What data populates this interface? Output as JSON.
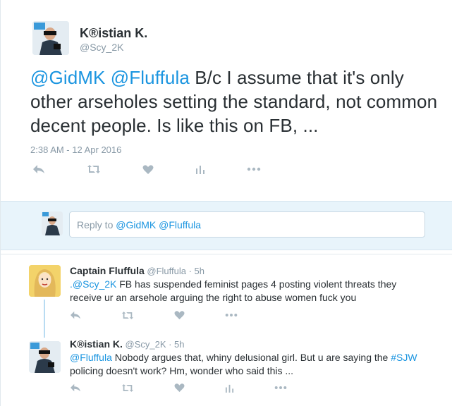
{
  "main_tweet": {
    "name": "K®istian K.",
    "handle": "@Scy_2K",
    "mention1": "@GidMK",
    "mention2": "@Fluffula",
    "body": " B/c I assume that it's only other arseholes setting the standard, not common decent people. Is like this on FB, ...",
    "timestamp": "2:38 AM - 12 Apr 2016",
    "icons": [
      "reply-icon",
      "retweet-icon",
      "like-icon",
      "analytics-icon",
      "more-icon"
    ]
  },
  "reply_box": {
    "prefix": "Reply to ",
    "mentions": "@GidMK @Fluffula"
  },
  "conversation": [
    {
      "name": "Captain Fluffula",
      "handle_meta": " @Fluffula · 5h",
      "mention": ".@Scy_2K",
      "body": " FB has suspended feminist pages 4 posting violent threats they receive ur an arsehole arguing the right to abuse women fuck you"
    },
    {
      "name": "K®istian K.",
      "handle_meta": " @Scy_2K · 5h",
      "mention": "@Fluffula",
      "body_part1": " Nobody argues that, whiny delusional girl. But u are saying the ",
      "hashtag": "#SJW",
      "body_part2": " policing doesn't work? Hm, wonder who said this ..."
    }
  ],
  "colors": {
    "link": "#1b95e0",
    "text": "#292f33",
    "muted": "#8899a6",
    "icon": "#aab8c2",
    "reply_bg": "#e8f4fb"
  }
}
